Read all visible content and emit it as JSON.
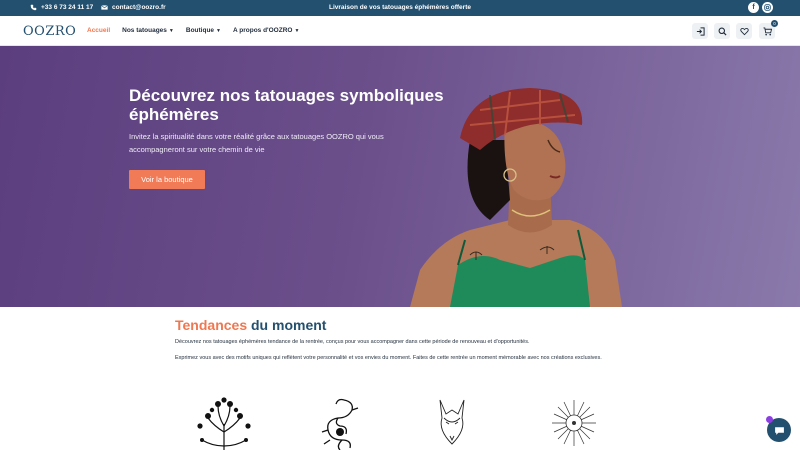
{
  "topbar": {
    "phone": "+33 6 73 24 11 17",
    "email": "contact@oozro.fr",
    "promo": "Livraison de vos tatouages éphémères offerte",
    "social": [
      "facebook-icon",
      "instagram-icon"
    ]
  },
  "header": {
    "logo": "OOZRO",
    "nav": [
      {
        "label": "Accueil",
        "active": true,
        "dropdown": false
      },
      {
        "label": "Nos tatouages",
        "active": false,
        "dropdown": true
      },
      {
        "label": "Boutique",
        "active": false,
        "dropdown": true
      },
      {
        "label": "A propos d'OOZRO",
        "active": false,
        "dropdown": true
      }
    ],
    "icons": [
      "login-icon",
      "search-icon",
      "heart-icon",
      "cart-icon"
    ],
    "cart_count": "0"
  },
  "hero": {
    "title": "Découvrez nos tatouages symboliques éphémères",
    "subtitle": "Invitez la spiritualité dans votre réalité grâce aux tatouages OOZRO qui vous accompagneront sur votre chemin de vie",
    "button": "Voir la boutique"
  },
  "trends": {
    "title_accent": "Tendances",
    "title_rest": "du moment",
    "p1": "Découvrez nos tatouages éphémères tendance de la rentrée, conçus pour vous accompagner dans cette période de renouveau et d'opportunités.",
    "p2": "Exprimez vous avec des motifs uniques qui reflètent votre personnalité et vos envies du moment. Faites de cette rentrée un moment mémorable avec nos créations exclusives.",
    "motifs": [
      "tree-of-life-motif",
      "dragon-motif",
      "fox-motif",
      "sun-motif"
    ]
  },
  "colors": {
    "topbar": "#24506f",
    "accent": "#f0774f",
    "hero_start": "#5b3e7e",
    "hero_end": "#8a79ab"
  }
}
